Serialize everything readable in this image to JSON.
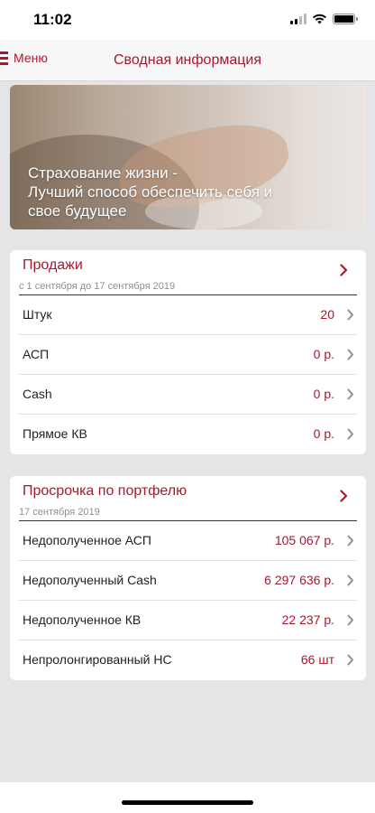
{
  "status_bar": {
    "time": "11:02",
    "battery_level": 1.0
  },
  "nav": {
    "menu_label": "Меню",
    "title": "Сводная информация"
  },
  "banner": {
    "line1": "Страхование жизни -",
    "line2": "Лучший способ обеспечить себя и",
    "line3": "свое будущее"
  },
  "sales": {
    "title": "Продажи",
    "period": "с 1 сентября до 17 сентября 2019",
    "rows": [
      {
        "label": "Штук",
        "value": "20"
      },
      {
        "label": "АСП",
        "value": "0 р."
      },
      {
        "label": "Cash",
        "value": "0 р."
      },
      {
        "label": "Прямое КВ",
        "value": "0 р."
      }
    ]
  },
  "overdue": {
    "title": "Просрочка по портфелю",
    "date": "17 сентября 2019",
    "rows": [
      {
        "label": "Недополученное АСП",
        "value": "105 067 р."
      },
      {
        "label": "Недополученный Cash",
        "value": "6 297 636 р."
      },
      {
        "label": "Недополученное КВ",
        "value": "22 237 р."
      },
      {
        "label": "Непролонгированный НС",
        "value": "66 шт"
      }
    ]
  },
  "colors": {
    "accent": "#a6192e",
    "background": "#e5e5e8",
    "chevron": "#8e8e93"
  },
  "icons": {
    "menu": "hamburger-icon",
    "row_chevron": "chevron-right-icon",
    "wifi": "wifi-icon",
    "signal": "cellular-signal-icon",
    "battery": "battery-icon"
  }
}
